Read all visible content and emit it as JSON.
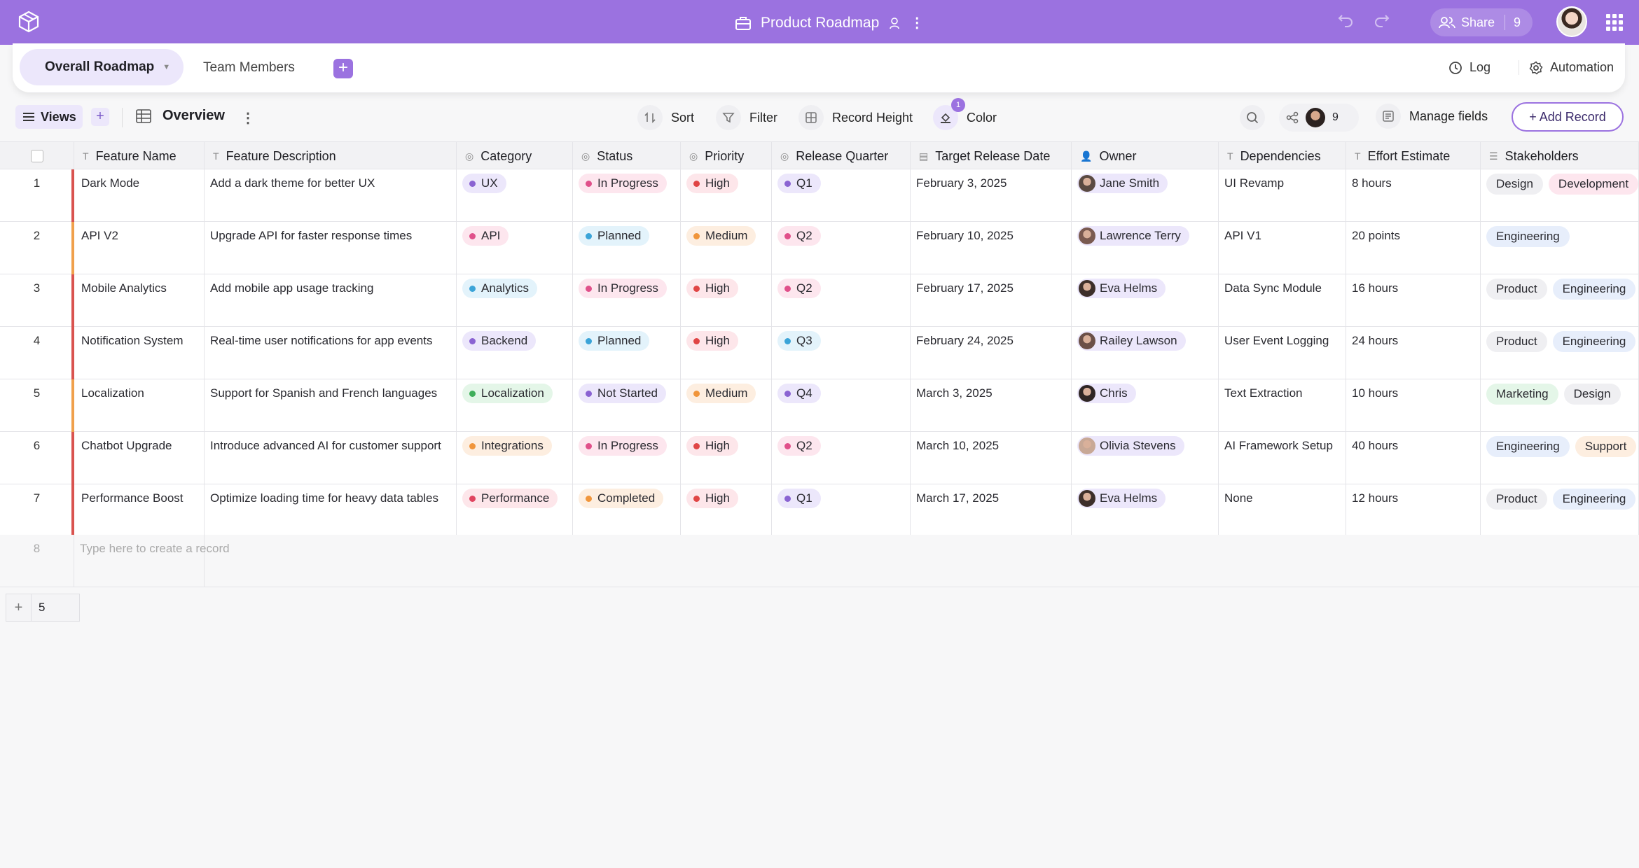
{
  "app": {
    "title": "Product Roadmap",
    "share_label": "Share",
    "share_count": "9",
    "colors": {
      "brand": "#9b72e0",
      "tab_active_bg": "#ece7fb"
    }
  },
  "tabs": [
    {
      "label": "Overall Roadmap",
      "active": true
    },
    {
      "label": "Team Members",
      "active": false
    }
  ],
  "header_actions": {
    "log": "Log",
    "automation": "Automation"
  },
  "toolbar": {
    "views": "Views",
    "view_name": "Overview",
    "sort": "Sort",
    "filter": "Filter",
    "record_height": "Record Height",
    "color": "Color",
    "color_badge": "1",
    "collaborators_count": "9",
    "manage_fields": "Manage fields",
    "add_record": "+ Add Record"
  },
  "columns": [
    {
      "label": "Feature Name",
      "icon": "text-field-icon"
    },
    {
      "label": "Feature Description",
      "icon": "text-field-icon"
    },
    {
      "label": "Category",
      "icon": "single-select-icon"
    },
    {
      "label": "Status",
      "icon": "single-select-icon"
    },
    {
      "label": "Priority",
      "icon": "single-select-icon"
    },
    {
      "label": "Release Quarter",
      "icon": "single-select-icon"
    },
    {
      "label": "Target Release Date",
      "icon": "calendar-icon"
    },
    {
      "label": "Owner",
      "icon": "person-icon"
    },
    {
      "label": "Dependencies",
      "icon": "text-field-icon"
    },
    {
      "label": "Effort Estimate",
      "icon": "text-field-icon"
    },
    {
      "label": "Stakeholders",
      "icon": "multi-select-icon"
    }
  ],
  "rows": [
    {
      "num": "1",
      "name": "Dark Mode",
      "desc": "Add a dark theme for better UX",
      "category": "UX",
      "status": "In Progress",
      "priority": "High",
      "quarter": "Q1",
      "date": "February 3, 2025",
      "owner": "Jane Smith",
      "deps": "UI Revamp",
      "effort": "8 hours",
      "stakeholders": [
        "Design",
        "Development"
      ],
      "bar_color": "#d9534f"
    },
    {
      "num": "2",
      "name": "API V2",
      "desc": "Upgrade API for faster response times",
      "category": "API",
      "status": "Planned",
      "priority": "Medium",
      "quarter": "Q2",
      "date": "February 10, 2025",
      "owner": "Lawrence Terry",
      "deps": "API V1",
      "effort": "20 points",
      "stakeholders": [
        "Engineering"
      ],
      "bar_color": "#f0a04b"
    },
    {
      "num": "3",
      "name": "Mobile Analytics",
      "desc": "Add mobile app usage tracking",
      "category": "Analytics",
      "status": "In Progress",
      "priority": "High",
      "quarter": "Q2",
      "date": "February 17, 2025",
      "owner": "Eva Helms",
      "deps": "Data Sync Module",
      "effort": "16 hours",
      "stakeholders": [
        "Product",
        "Engineering"
      ],
      "bar_color": "#d9534f"
    },
    {
      "num": "4",
      "name": "Notification System",
      "desc": "Real-time user notifications for app events",
      "category": "Backend",
      "status": "Planned",
      "priority": "High",
      "quarter": "Q3",
      "date": "February 24, 2025",
      "owner": "Railey Lawson",
      "deps": "User Event Logging",
      "effort": "24 hours",
      "stakeholders": [
        "Product",
        "Engineering"
      ],
      "bar_color": "#d9534f"
    },
    {
      "num": "5",
      "name": "Localization",
      "desc": "Support for Spanish and French languages",
      "category": "Localization",
      "status": "Not Started",
      "priority": "Medium",
      "quarter": "Q4",
      "date": "March 3, 2025",
      "owner": "Chris",
      "deps": "Text Extraction",
      "effort": "10 hours",
      "stakeholders": [
        "Marketing",
        "Design"
      ],
      "bar_color": "#f0a04b"
    },
    {
      "num": "6",
      "name": "Chatbot Upgrade",
      "desc": "Introduce advanced AI for customer support",
      "category": "Integrations",
      "status": "In Progress",
      "priority": "High",
      "quarter": "Q2",
      "date": "March 10, 2025",
      "owner": "Olivia Stevens",
      "deps": "AI Framework Setup",
      "effort": "40 hours",
      "stakeholders": [
        "Engineering",
        "Support"
      ],
      "bar_color": "#d9534f"
    },
    {
      "num": "7",
      "name": "Performance Boost",
      "desc": "Optimize loading time for heavy data tables",
      "category": "Performance",
      "status": "Completed",
      "priority": "High",
      "quarter": "Q1",
      "date": "March 17, 2025",
      "owner": "Eva Helms",
      "deps": "None",
      "effort": "12 hours",
      "stakeholders": [
        "Product",
        "Engineering"
      ],
      "bar_color": "#d9534f"
    }
  ],
  "new_row": {
    "num": "8",
    "placeholder": "Type here to create a record"
  },
  "footer": {
    "record_count": "5"
  },
  "tag_styles": {
    "category": {
      "UX": {
        "bg": "#ece7fb",
        "dot": "#8a63d2"
      },
      "API": {
        "bg": "#fde6ee",
        "dot": "#e0508a"
      },
      "Analytics": {
        "bg": "#e3f3fb",
        "dot": "#3ba4d8"
      },
      "Backend": {
        "bg": "#ece7fb",
        "dot": "#8a63d2"
      },
      "Localization": {
        "bg": "#e4f6e8",
        "dot": "#3fae5a"
      },
      "Integrations": {
        "bg": "#fdeee0",
        "dot": "#f0953b"
      },
      "Performance": {
        "bg": "#fde6ea",
        "dot": "#e04560"
      }
    },
    "status": {
      "In Progress": {
        "bg": "#fde6ee",
        "dot": "#e0508a"
      },
      "Planned": {
        "bg": "#e3f3fb",
        "dot": "#3ba4d8"
      },
      "Not Started": {
        "bg": "#ece7fb",
        "dot": "#8a63d2"
      },
      "Completed": {
        "bg": "#fdeee0",
        "dot": "#f0953b"
      }
    },
    "priority": {
      "High": {
        "bg": "#fde6ea",
        "dot": "#e04545"
      },
      "Medium": {
        "bg": "#fdeee0",
        "dot": "#f0953b"
      }
    },
    "quarter": {
      "Q1": {
        "bg": "#ece7fb",
        "dot": "#8a63d2"
      },
      "Q2": {
        "bg": "#fde6ee",
        "dot": "#e0508a"
      },
      "Q3": {
        "bg": "#e3f3fb",
        "dot": "#3ba4d8"
      },
      "Q4": {
        "bg": "#ece7fb",
        "dot": "#8a63d2"
      }
    },
    "stakeholders": {
      "Design": "#efeff2",
      "Development": "#fde6ee",
      "Engineering": "#e7eefb",
      "Product": "#efeff2",
      "Marketing": "#e4f6e8",
      "Support": "#fdeee0"
    }
  }
}
